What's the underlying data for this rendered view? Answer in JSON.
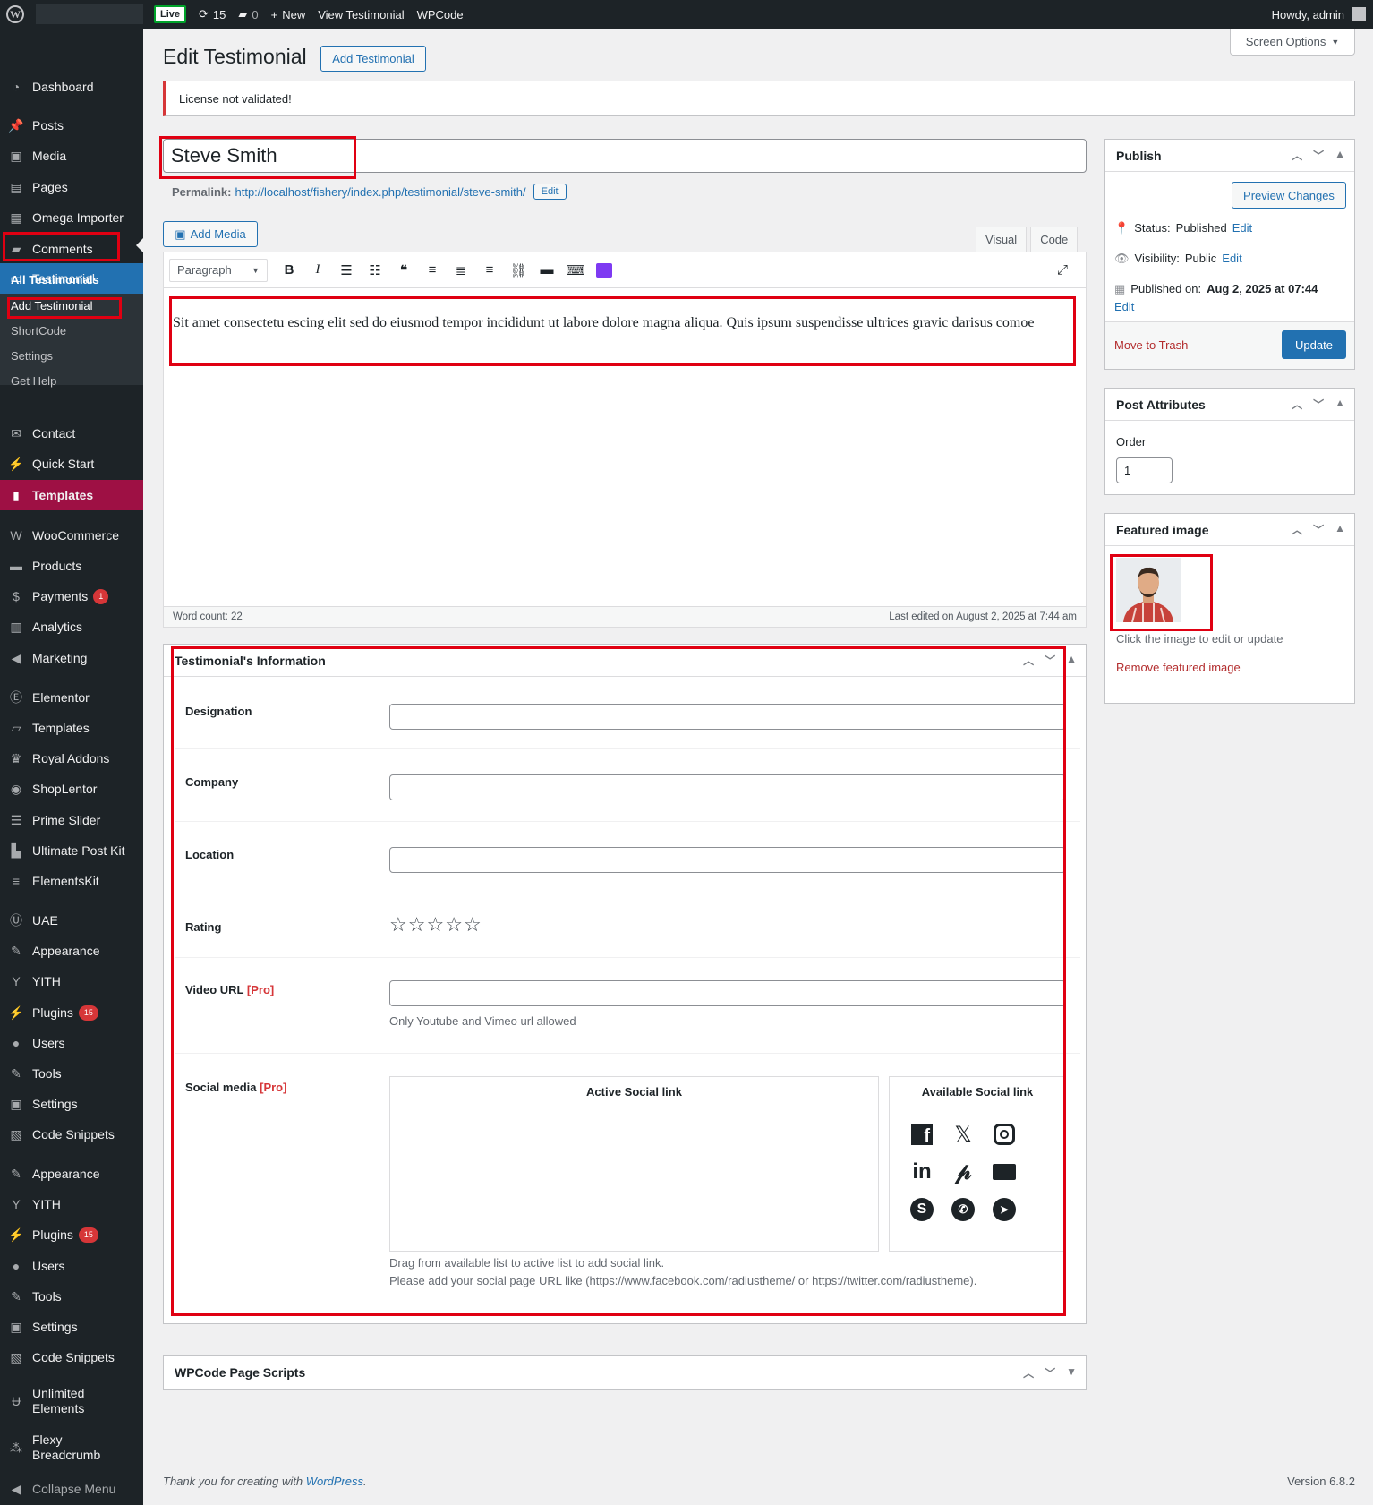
{
  "adminbar": {
    "live": "Live",
    "updates_count": "15",
    "comments_count": "0",
    "new_label": "New",
    "view_label": "View Testimonial",
    "wpcode_label": "WPCode",
    "howdy": "Howdy, admin"
  },
  "sidebar": {
    "items": [
      {
        "label": "Dashboard",
        "icon": "dashboard-icon"
      },
      {
        "label": "Posts",
        "icon": "pin-icon"
      },
      {
        "label": "Media",
        "icon": "media-icon"
      },
      {
        "label": "Pages",
        "icon": "pages-icon"
      },
      {
        "label": "Omega Importer",
        "icon": "grid-icon"
      },
      {
        "label": "Comments",
        "icon": "comment-icon"
      },
      {
        "label": "Testimonial",
        "icon": "testimonial-icon"
      },
      {
        "label": "Contact",
        "icon": "mail-icon"
      },
      {
        "label": "Quick Start",
        "icon": "plug-icon"
      },
      {
        "label": "Templates",
        "icon": "templates-icon"
      },
      {
        "label": "WooCommerce",
        "icon": "woo-icon"
      },
      {
        "label": "Products",
        "icon": "box-icon"
      },
      {
        "label": "Payments",
        "icon": "dollar-icon",
        "badge": "1"
      },
      {
        "label": "Analytics",
        "icon": "bar-chart-icon"
      },
      {
        "label": "Marketing",
        "icon": "megaphone-icon"
      },
      {
        "label": "Elementor",
        "icon": "elementor-icon"
      },
      {
        "label": "Templates",
        "icon": "folder-icon"
      },
      {
        "label": "Royal Addons",
        "icon": "crown-icon"
      },
      {
        "label": "ShopLentor",
        "icon": "shoplentor-icon"
      },
      {
        "label": "Prime Slider",
        "icon": "slider-icon"
      },
      {
        "label": "Ultimate Post Kit",
        "icon": "postkit-icon"
      },
      {
        "label": "ElementsKit",
        "icon": "elementskit-icon"
      },
      {
        "label": "UAE",
        "icon": "uae-icon"
      },
      {
        "label": "Appearance",
        "icon": "brush-icon"
      },
      {
        "label": "YITH",
        "icon": "yith-icon"
      },
      {
        "label": "Plugins",
        "icon": "plugin-icon",
        "badge": "15"
      },
      {
        "label": "Users",
        "icon": "user-icon"
      },
      {
        "label": "Tools",
        "icon": "wrench-icon"
      },
      {
        "label": "Settings",
        "icon": "settings-icon"
      },
      {
        "label": "Code Snippets",
        "icon": "code-icon"
      },
      {
        "label": "Appearance",
        "icon": "brush-icon"
      },
      {
        "label": "YITH",
        "icon": "yith-icon"
      },
      {
        "label": "Plugins",
        "icon": "plugin-icon",
        "badge": "15"
      },
      {
        "label": "Users",
        "icon": "user-icon"
      },
      {
        "label": "Tools",
        "icon": "wrench-icon"
      },
      {
        "label": "Settings",
        "icon": "settings-icon"
      },
      {
        "label": "Code Snippets",
        "icon": "code-icon"
      },
      {
        "label": "Unlimited Elements",
        "icon": "unlimited-icon"
      },
      {
        "label": "Flexy Breadcrumb",
        "icon": "breadcrumb-icon"
      },
      {
        "label": "Collapse Menu",
        "icon": "collapse-icon"
      }
    ],
    "submenu": [
      "All Testimonials",
      "Add Testimonial",
      "ShortCode",
      "Settings",
      "Get Help"
    ]
  },
  "page": {
    "title": "Edit Testimonial",
    "add_button": "Add Testimonial",
    "screen_options": "Screen Options",
    "notice": "License not validated!",
    "post_title": "Steve Smith",
    "permalink_label": "Permalink:",
    "permalink_url": "http://localhost/fishery/index.php/testimonial/steve-smith/",
    "permalink_edit": "Edit",
    "add_media": "Add Media",
    "tab_visual": "Visual",
    "tab_code": "Code",
    "format_select": "Paragraph",
    "content": "Sit amet consectetu escing elit sed do eiusmod tempor incididunt ut labore dolore magna aliqua. Quis ipsum suspendisse ultrices gravic darisus comoe",
    "word_count": "Word count: 22",
    "last_edited": "Last edited on August 2, 2025 at 7:44 am"
  },
  "info_box": {
    "title": "Testimonial's Information",
    "designation": "Designation",
    "company": "Company",
    "location": "Location",
    "rating": "Rating",
    "rating_value": 0,
    "rating_max": 5,
    "video_label": "Video URL",
    "pro_tag": "[Pro]",
    "video_help": "Only Youtube and Vimeo url allowed",
    "social_label": "Social media",
    "active_social": "Active Social link",
    "available_social": "Available Social link",
    "social_help_1": "Drag from available list to active list to add social link.",
    "social_help_2": "Please add your social page URL like (https://www.facebook.com/radiustheme/ or https://twitter.com/radiustheme).",
    "social_icons": [
      "facebook-icon",
      "x-icon",
      "instagram-icon",
      "linkedin-icon",
      "pinterest-icon",
      "envelope-icon",
      "skype-icon",
      "whatsapp-icon",
      "telegram-icon"
    ]
  },
  "wpcode_box": {
    "title": "WPCode Page Scripts"
  },
  "publish": {
    "title": "Publish",
    "preview": "Preview Changes",
    "status_label": "Status:",
    "status_value": "Published",
    "visibility_label": "Visibility:",
    "visibility_value": "Public",
    "published_label": "Published on:",
    "published_value": "Aug 2, 2025 at 07:44",
    "edit": "Edit",
    "trash": "Move to Trash",
    "update": "Update"
  },
  "attributes": {
    "title": "Post Attributes",
    "order_label": "Order",
    "order_value": "1"
  },
  "featured": {
    "title": "Featured image",
    "hint": "Click the image to edit or update",
    "remove": "Remove featured image"
  },
  "footer": {
    "thanks": "Thank you for creating with ",
    "wp_link": "WordPress",
    "thanks_end": ".",
    "version": "Version 6.8.2"
  },
  "colors": {
    "accent": "#2271b1",
    "sidebar": "#1d2327",
    "highlight": "#e00012",
    "templates_bg": "#9e1044"
  }
}
